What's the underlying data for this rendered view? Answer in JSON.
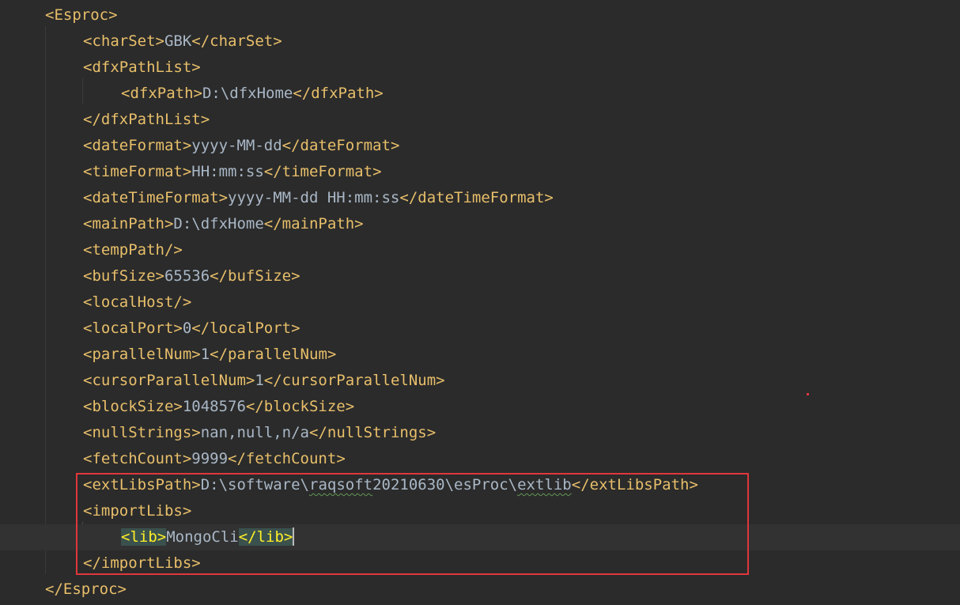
{
  "lines": [
    {
      "indent": 0,
      "parts": [
        {
          "t": "tag",
          "v": "<Esproc>"
        }
      ]
    },
    {
      "indent": 1,
      "parts": [
        {
          "t": "tag",
          "v": "<charSet>"
        },
        {
          "t": "txt",
          "v": "GBK"
        },
        {
          "t": "tag",
          "v": "</charSet>"
        }
      ]
    },
    {
      "indent": 1,
      "parts": [
        {
          "t": "tag",
          "v": "<dfxPathList>"
        }
      ]
    },
    {
      "indent": 2,
      "parts": [
        {
          "t": "tag",
          "v": "<dfxPath>"
        },
        {
          "t": "txt",
          "v": "D:\\dfxHome"
        },
        {
          "t": "tag",
          "v": "</dfxPath>"
        }
      ]
    },
    {
      "indent": 1,
      "parts": [
        {
          "t": "tag",
          "v": "</dfxPathList>"
        }
      ]
    },
    {
      "indent": 1,
      "parts": [
        {
          "t": "tag",
          "v": "<dateFormat>"
        },
        {
          "t": "txt",
          "v": "yyyy-MM-dd"
        },
        {
          "t": "tag",
          "v": "</dateFormat>"
        }
      ]
    },
    {
      "indent": 1,
      "parts": [
        {
          "t": "tag",
          "v": "<timeFormat>"
        },
        {
          "t": "txt",
          "v": "HH:mm:ss"
        },
        {
          "t": "tag",
          "v": "</timeFormat>"
        }
      ]
    },
    {
      "indent": 1,
      "parts": [
        {
          "t": "tag",
          "v": "<dateTimeFormat>"
        },
        {
          "t": "txt",
          "v": "yyyy-MM-dd HH:mm:ss"
        },
        {
          "t": "tag",
          "v": "</dateTimeFormat>"
        }
      ]
    },
    {
      "indent": 1,
      "parts": [
        {
          "t": "tag",
          "v": "<mainPath>"
        },
        {
          "t": "txt",
          "v": "D:\\dfxHome"
        },
        {
          "t": "tag",
          "v": "</mainPath>"
        }
      ]
    },
    {
      "indent": 1,
      "parts": [
        {
          "t": "tag",
          "v": "<tempPath/>"
        }
      ]
    },
    {
      "indent": 1,
      "parts": [
        {
          "t": "tag",
          "v": "<bufSize>"
        },
        {
          "t": "txt",
          "v": "65536"
        },
        {
          "t": "tag",
          "v": "</bufSize>"
        }
      ]
    },
    {
      "indent": 1,
      "parts": [
        {
          "t": "tag",
          "v": "<localHost/>"
        }
      ]
    },
    {
      "indent": 1,
      "parts": [
        {
          "t": "tag",
          "v": "<localPort>"
        },
        {
          "t": "txt",
          "v": "0"
        },
        {
          "t": "tag",
          "v": "</localPort>"
        }
      ]
    },
    {
      "indent": 1,
      "parts": [
        {
          "t": "tag",
          "v": "<parallelNum>"
        },
        {
          "t": "txt",
          "v": "1"
        },
        {
          "t": "tag",
          "v": "</parallelNum>"
        }
      ]
    },
    {
      "indent": 1,
      "parts": [
        {
          "t": "tag",
          "v": "<cursorParallelNum>"
        },
        {
          "t": "txt",
          "v": "1"
        },
        {
          "t": "tag",
          "v": "</cursorParallelNum>"
        }
      ]
    },
    {
      "indent": 1,
      "parts": [
        {
          "t": "tag",
          "v": "<blockSize>"
        },
        {
          "t": "txt",
          "v": "1048576"
        },
        {
          "t": "tag",
          "v": "</blockSize>"
        }
      ]
    },
    {
      "indent": 1,
      "parts": [
        {
          "t": "tag",
          "v": "<nullStrings>"
        },
        {
          "t": "txt",
          "v": "nan,null,n/a"
        },
        {
          "t": "tag",
          "v": "</nullStrings>"
        }
      ]
    },
    {
      "indent": 1,
      "parts": [
        {
          "t": "tag",
          "v": "<fetchCount>"
        },
        {
          "t": "txt",
          "v": "9999"
        },
        {
          "t": "tag",
          "v": "</fetchCount>"
        }
      ]
    },
    {
      "indent": 1,
      "parts": [
        {
          "t": "tag",
          "v": "<extLibsPath>"
        },
        {
          "t": "txt",
          "v": "D:\\software\\"
        },
        {
          "t": "typo",
          "v": "raqsoft"
        },
        {
          "t": "txt",
          "v": "20210630\\esProc\\"
        },
        {
          "t": "typo",
          "v": "extlib"
        },
        {
          "t": "tag",
          "v": "</extLibsPath>"
        }
      ]
    },
    {
      "indent": 1,
      "parts": [
        {
          "t": "tag",
          "v": "<importLibs>"
        }
      ]
    },
    {
      "indent": 2,
      "current": true,
      "parts": [
        {
          "t": "hl",
          "v": "<lib>"
        },
        {
          "t": "txt",
          "v": "MongoCli"
        },
        {
          "t": "hl",
          "v": "</lib>"
        },
        {
          "t": "caret",
          "v": ""
        }
      ]
    },
    {
      "indent": 1,
      "parts": [
        {
          "t": "tag",
          "v": "</importLibs>"
        }
      ]
    },
    {
      "indent": 0,
      "parts": [
        {
          "t": "tag",
          "v": "</Esproc>"
        }
      ]
    }
  ],
  "colors": {
    "background": "#2b2b2b",
    "tag": "#e8bf6a",
    "text": "#a9b7c6",
    "highlight_box": "#e0373c",
    "matched_tag_bg": "#3b514d"
  }
}
